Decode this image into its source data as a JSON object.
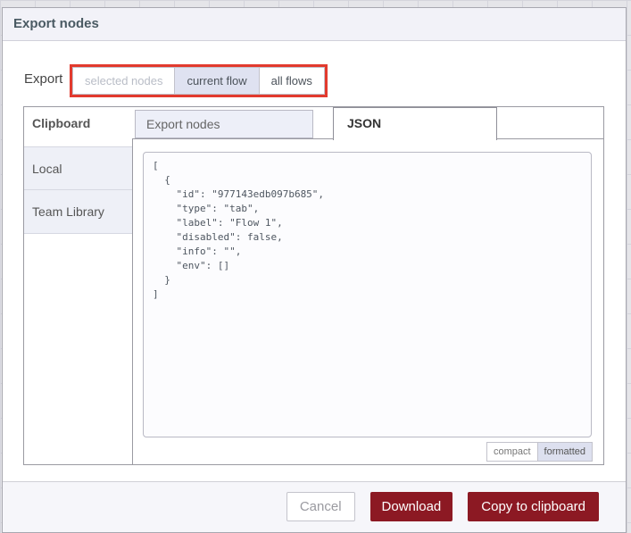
{
  "window": {
    "title": "Export nodes"
  },
  "export_row": {
    "label": "Export",
    "options": [
      {
        "label": "selected nodes",
        "state": "disabled"
      },
      {
        "label": "current flow",
        "state": "selected"
      },
      {
        "label": "all flows",
        "state": "normal"
      }
    ],
    "selected_option": "current flow"
  },
  "library": {
    "sidebar_header": "Clipboard",
    "sidebar_items": [
      {
        "label": "Local"
      },
      {
        "label": "Team Library"
      }
    ],
    "tabs": [
      {
        "label": "Export nodes",
        "active": false
      },
      {
        "label": "JSON",
        "active": true
      }
    ],
    "active_tab": "JSON",
    "json_text": "[\n  {\n    \"id\": \"977143edb097b685\",\n    \"type\": \"tab\",\n    \"label\": \"Flow 1\",\n    \"disabled\": false,\n    \"info\": \"\",\n    \"env\": []\n  }\n]",
    "format_options": [
      {
        "label": "compact",
        "selected": false
      },
      {
        "label": "formatted",
        "selected": true
      }
    ],
    "format_selected": "formatted"
  },
  "footer": {
    "cancel_label": "Cancel",
    "download_label": "Download",
    "copy_label": "Copy to clipboard"
  },
  "colors": {
    "primary_button": "#8C1923",
    "annotation_box": "#E23A2E",
    "selected_option_bg": "#DFE2F1",
    "inactive_tab_bg": "#EDEFF8",
    "sidebar_item_bg": "#EEF0F7",
    "header_bg": "#F2F2F8",
    "title_text": "#4A5A63"
  }
}
